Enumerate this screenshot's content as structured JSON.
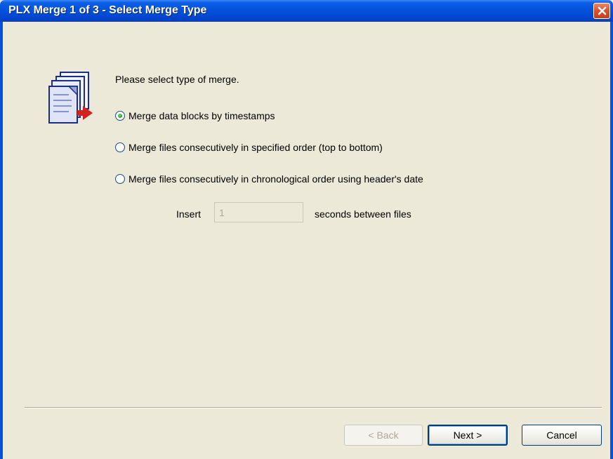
{
  "window": {
    "title": "PLX Merge 1 of 3 - Select Merge Type"
  },
  "icons": {
    "close": "close-icon",
    "logo": "merge-files-icon"
  },
  "content": {
    "prompt": "Please select type of merge.",
    "options": [
      {
        "label": "Merge data blocks by timestamps",
        "selected": true
      },
      {
        "label": "Merge files consecutively in specified order (top to bottom)",
        "selected": false
      },
      {
        "label": "Merge files consecutively in chronological order using header's date",
        "selected": false
      }
    ],
    "insert": {
      "label": "Insert",
      "value": "1",
      "suffix": "seconds between files",
      "enabled": false
    }
  },
  "buttons": {
    "back": "< Back",
    "next": "Next >",
    "cancel": "Cancel"
  },
  "colors": {
    "titlebar": "#0453dd",
    "face": "#ece9d8",
    "close": "#d9542a"
  }
}
